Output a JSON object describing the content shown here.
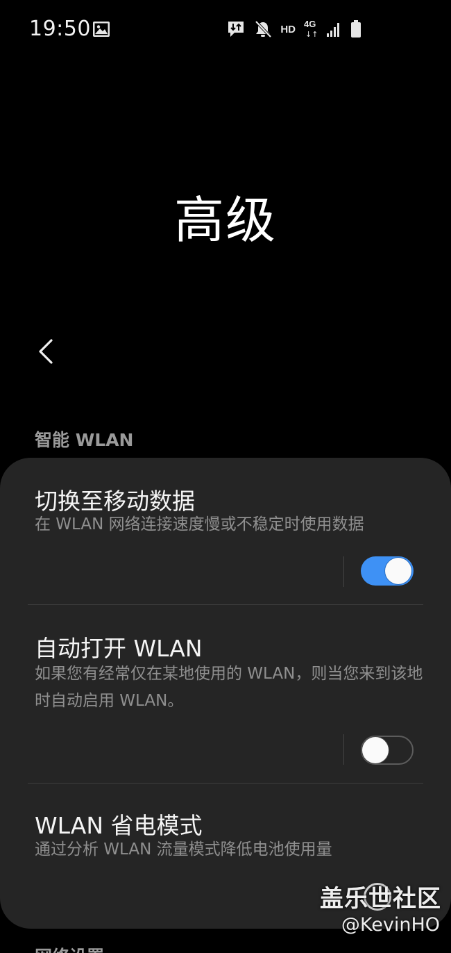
{
  "status_bar": {
    "time": "19:50",
    "hd": "HD",
    "network_type": "4G",
    "network_arrows": "↓↑"
  },
  "page": {
    "title": "高级"
  },
  "sections": {
    "smart_wlan_header": "智能 WLAN",
    "next_header": "网络设置"
  },
  "settings": [
    {
      "title": "切换至移动数据",
      "description": "在 WLAN 网络连接速度慢或不稳定时使用数据",
      "enabled": true
    },
    {
      "title": "自动打开 WLAN",
      "description": "如果您有经常仅在某地使用的 WLAN，则当您来到该地时自动启用 WLAN。",
      "enabled": false
    },
    {
      "title": "WLAN 省电模式",
      "description": "通过分析 WLAN 流量模式降低电池使用量",
      "enabled": false
    }
  ],
  "watermark": {
    "logo": "盖乐世社区",
    "user": "@KevinHO"
  },
  "colors": {
    "background": "#000000",
    "card": "#252525",
    "accent": "#3e91f5"
  }
}
